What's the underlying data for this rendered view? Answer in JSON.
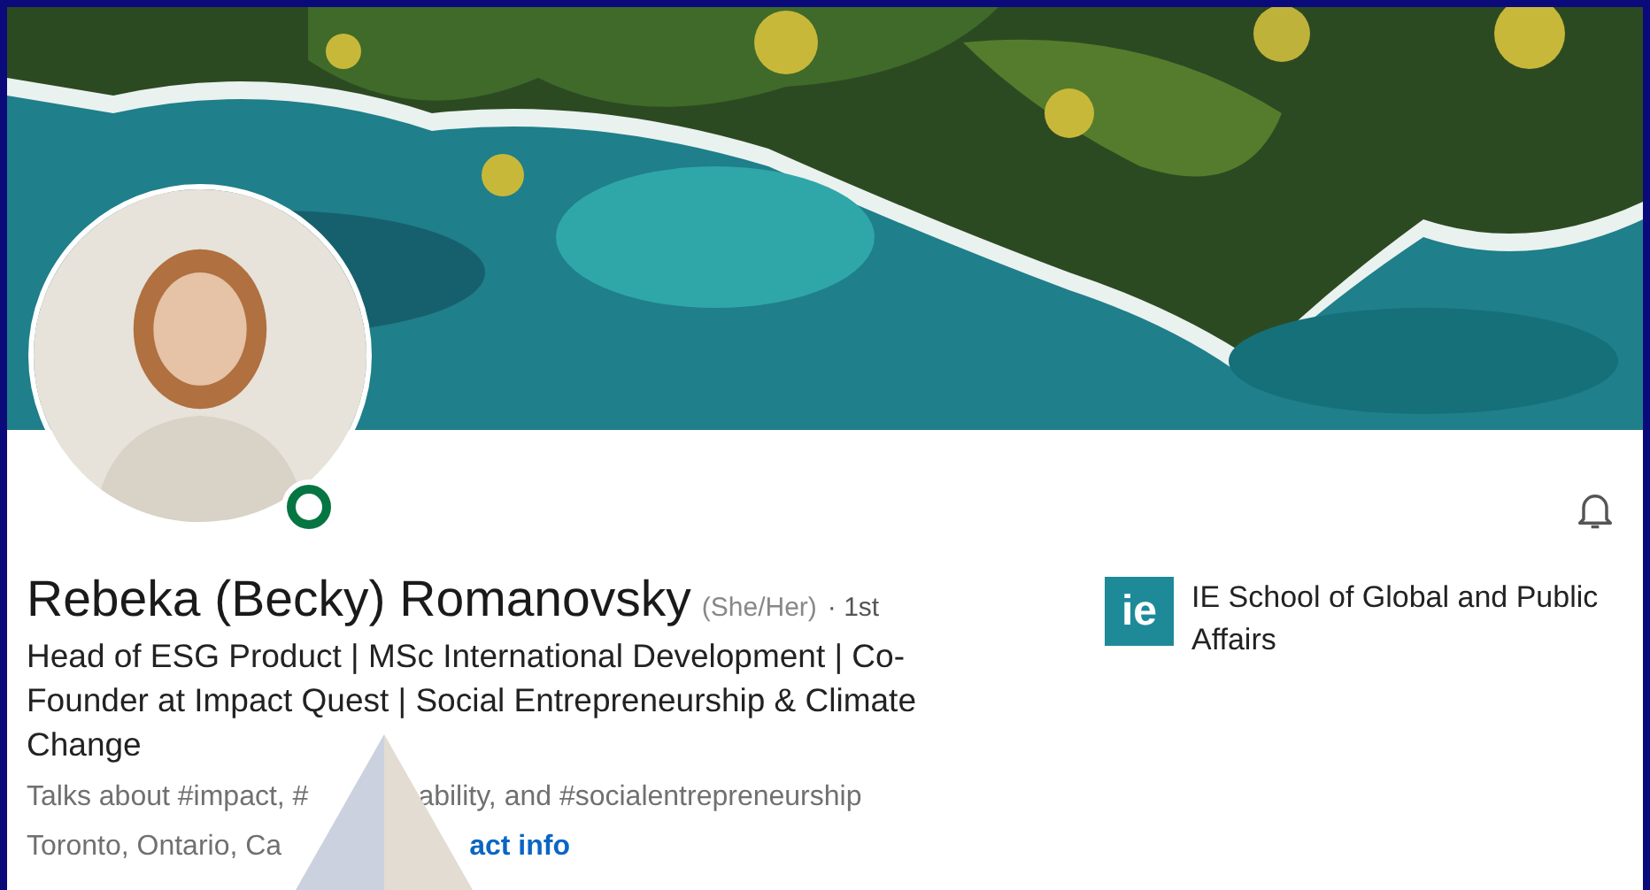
{
  "profile": {
    "name": "Rebeka (Becky) Romanovsky",
    "pronouns": "(She/Her)",
    "degree": "· 1st",
    "online": true,
    "headline": "Head of ESG Product | MSc International Development | Co-Founder at Impact Quest | Social Entrepreneurship & Climate Change",
    "talks_about": [
      "Talks about #impact, #",
      "ability, and #socialentrepreneurship"
    ],
    "location": "Toronto, Ontario, Ca",
    "contact_link": "act info"
  },
  "education": {
    "logo_text": "ie",
    "school": "IE School of Global and Public Affairs"
  }
}
